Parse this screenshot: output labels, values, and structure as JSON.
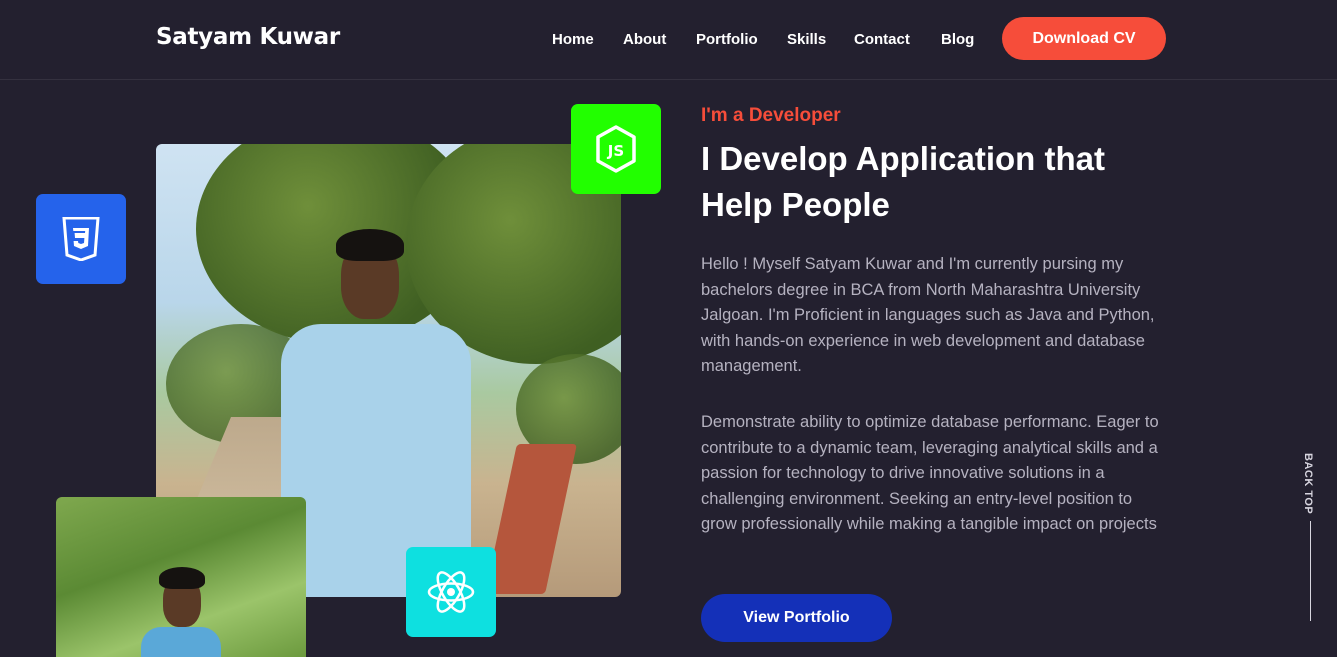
{
  "header": {
    "logo": "Satyam Kuwar",
    "nav": [
      "Home",
      "About",
      "Portfolio",
      "Skills",
      "Contact",
      "Blog"
    ],
    "cta_label": "Download CV"
  },
  "hero": {
    "tagline": "I'm a Developer",
    "headline": "I Develop Application that Help People",
    "paragraphs": [
      "Hello ! Myself Satyam Kuwar and I'm currently pursing my bachelors degree in BCA from North Maharashtra University Jalgoan. I'm Proficient in languages such as Java and Python, with hands-on experience in web development and database management.",
      "Demonstrate ability to optimize database performanc. Eager to contribute to a dynamic team, leveraging analytical skills and a passion for technology to drive innovative solutions in a challenging environment. Seeking an entry-level position to grow professionally while making a tangible impact on projects"
    ],
    "cta_label": "View Portfolio"
  },
  "tech_icons": [
    "css3-icon",
    "nodejs-icon",
    "react-icon"
  ],
  "back_to_top": "BACK TOP",
  "colors": {
    "background": "#23202f",
    "accent": "#f64d3a",
    "primary_button": "#1430b8",
    "css3_tile": "#2563eb",
    "nodejs_tile": "#22ff00",
    "react_tile": "#0ee0e0"
  }
}
